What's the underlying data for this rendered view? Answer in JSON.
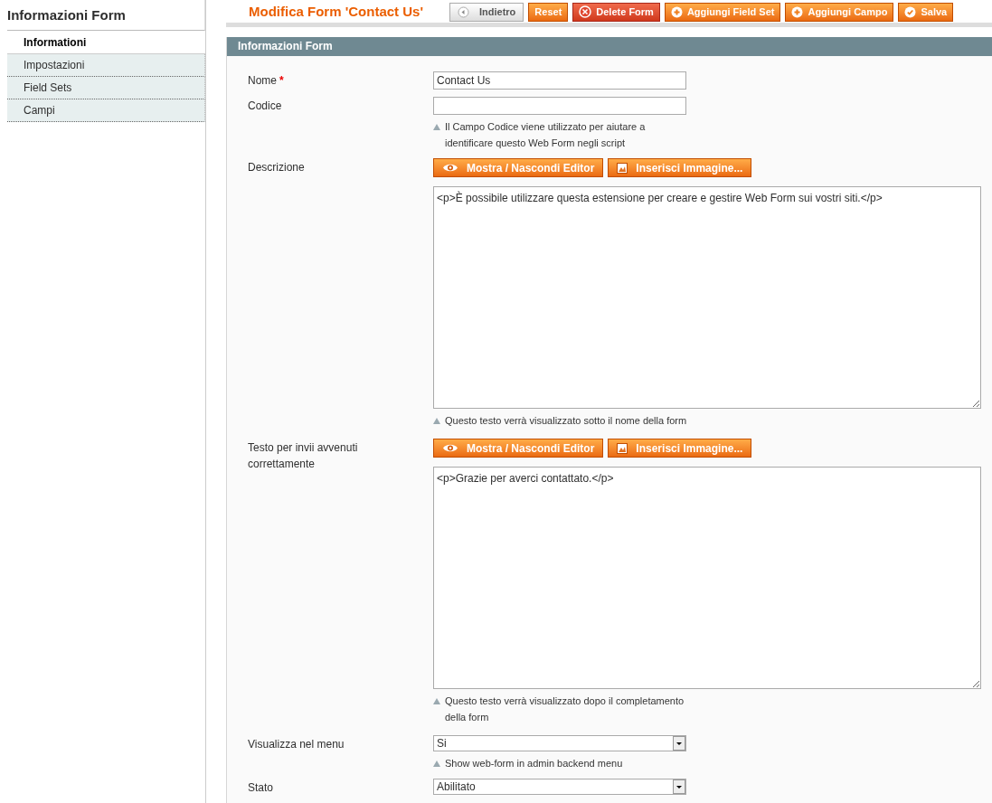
{
  "sidebar": {
    "title": "Informazioni Form",
    "items": [
      {
        "label": "Informationi",
        "selected": true
      },
      {
        "label": "Impostazioni",
        "selected": false
      },
      {
        "label": "Field Sets",
        "selected": false
      },
      {
        "label": "Campi",
        "selected": false
      }
    ]
  },
  "header": {
    "title": "Modifica Form 'Contact Us'",
    "buttons": [
      {
        "label": "Indietro",
        "kind": "back"
      },
      {
        "label": "Reset",
        "kind": "plain"
      },
      {
        "label": "Delete Form",
        "kind": "delete"
      },
      {
        "label": "Aggiungi Field Set",
        "kind": "add"
      },
      {
        "label": "Aggiungi Campo",
        "kind": "add"
      },
      {
        "label": "Salva",
        "kind": "save"
      }
    ]
  },
  "section": {
    "title": "Informazioni Form",
    "fields": [
      {
        "kind": "text",
        "label": "Nome",
        "required_mark": "*",
        "value": "Contact Us"
      },
      {
        "kind": "text",
        "label": "Codice",
        "note": "Il Campo Codice viene utilizzato per aiutare a identificare questo Web Form negli script"
      },
      {
        "kind": "editor",
        "label": "Descrizione",
        "buttons": [
          "Mostra / Nascondi Editor",
          "Inserisci Immagine..."
        ],
        "value": "<p>È possibile utilizzare questa estensione per creare e gestire Web Form sui vostri siti.</p>",
        "note": "Questo testo verrà visualizzato sotto il nome della form"
      },
      {
        "kind": "editor",
        "label": "Testo per invii avvenuti correttamente",
        "buttons": [
          "Mostra / Nascondi Editor",
          "Inserisci Immagine..."
        ],
        "value": "<p>Grazie per averci contattato.</p>",
        "note": "Questo testo verrà visualizzato dopo il completamento della form"
      },
      {
        "kind": "select",
        "label": "Visualizza nel menu",
        "value": "Si",
        "note": "Show web-form in admin backend menu"
      },
      {
        "kind": "select",
        "label": "Stato",
        "value": "Abilitato"
      }
    ]
  }
}
